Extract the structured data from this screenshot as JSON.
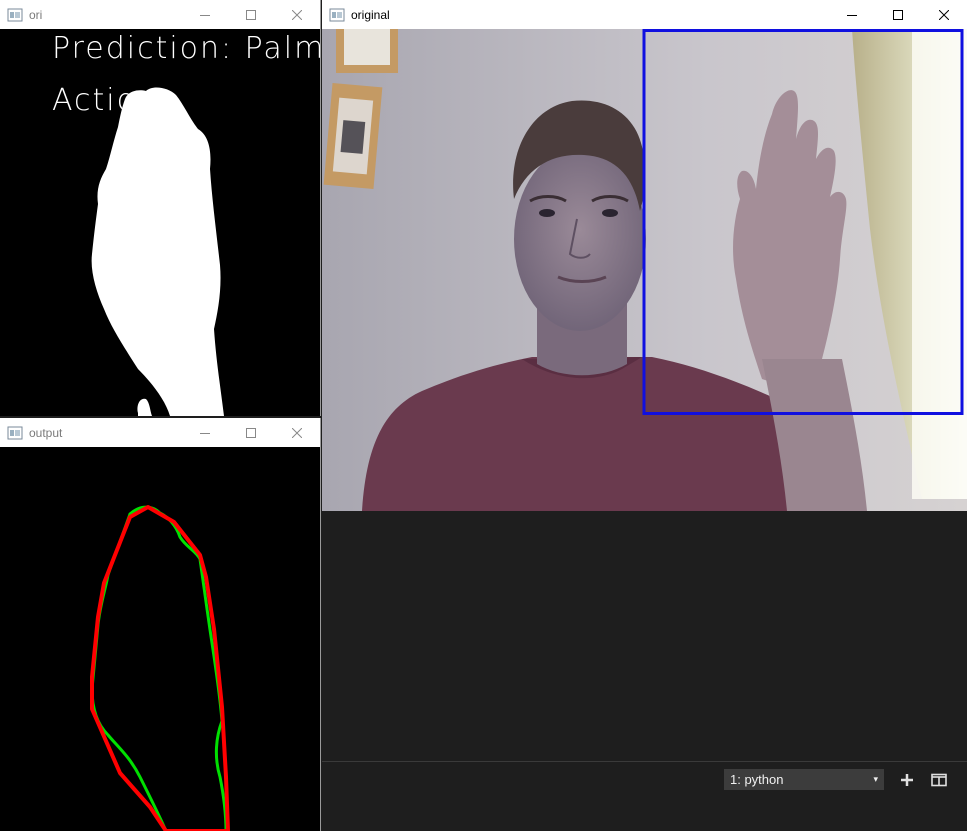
{
  "windows": {
    "ori": {
      "title": "ori",
      "prediction_text": "Prediction: Palm",
      "action_text": "Action"
    },
    "output": {
      "title": "output"
    },
    "original": {
      "title": "original"
    }
  },
  "terminal": {
    "dropdown": {
      "selected": "1: python",
      "arrow": "▾"
    },
    "new_terminal_icon": "plus-icon",
    "split_terminal_icon": "split-icon"
  },
  "colors": {
    "bounding_box": "#1010e0",
    "hull_red": "#ff0000",
    "contour_green": "#00e000",
    "terminal_bg": "#1e1e1e"
  }
}
